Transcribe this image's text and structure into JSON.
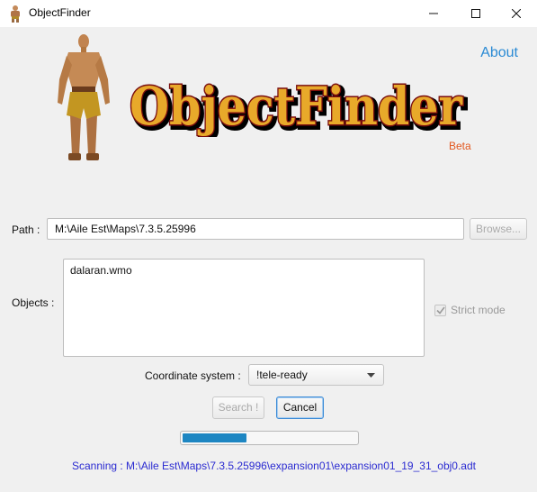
{
  "window": {
    "title": "ObjectFinder"
  },
  "header": {
    "about_label": "About",
    "logo_text": "ObjectFinder",
    "beta_label": "Beta"
  },
  "path": {
    "label": "Path :",
    "value": "M:\\Aile Est\\Maps\\7.3.5.25996",
    "browse_label": "Browse..."
  },
  "objects": {
    "label": "Objects :",
    "value": "dalaran.wmo"
  },
  "strict_mode": {
    "label": "Strict mode",
    "checked": true,
    "enabled": false
  },
  "coordinate": {
    "label": "Coordinate system :",
    "selected": "!tele-ready"
  },
  "actions": {
    "search_label": "Search !",
    "cancel_label": "Cancel"
  },
  "progress": {
    "fraction": 0.37
  },
  "status": {
    "text": "Scanning : M:\\Aile Est\\Maps\\7.3.5.25996\\expansion01\\expansion01_19_31_obj0.adt"
  },
  "colors": {
    "accent": "#2a8ad4",
    "beta": "#e2571e",
    "status": "#2b2bd1",
    "progress": "#1d86c2",
    "logo_fill": "#e8a92a",
    "logo_outline": "#7a0d0d"
  }
}
